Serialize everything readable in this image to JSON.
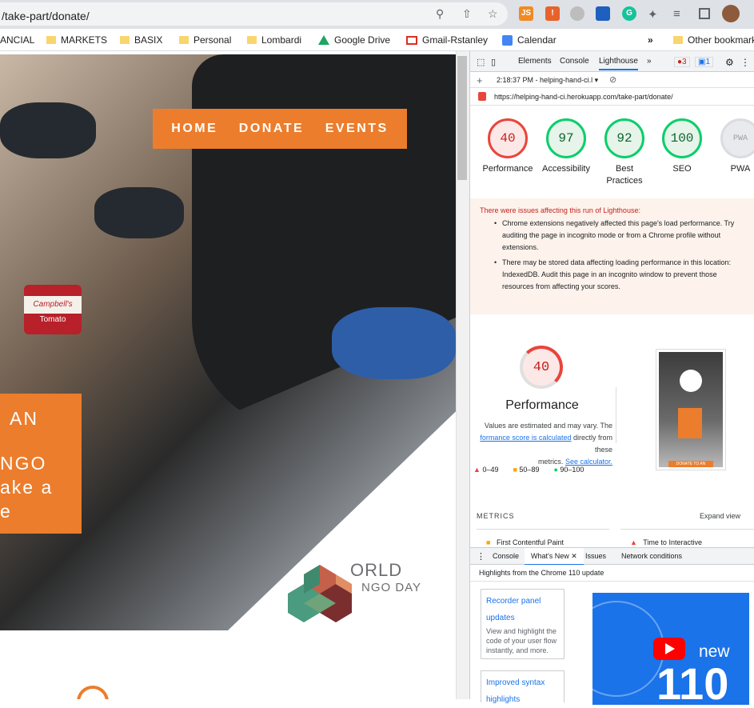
{
  "browser": {
    "url": "/take-part/donate/",
    "extensions": [
      "JS",
      "!",
      "",
      "",
      "G",
      "",
      "",
      ""
    ],
    "bookmarks": [
      "ANCIAL",
      "MARKETS",
      "BASIX",
      "Personal",
      "Lombardi",
      "Google Drive",
      "Gmail-Rstanley",
      "Calendar",
      "Other bookmarks"
    ],
    "more_bookmarks": "»"
  },
  "page": {
    "nav": [
      "HOME",
      "DONATE",
      "EVENTS"
    ],
    "hero_text": [
      "AN",
      "NGO",
      "ake a",
      "e"
    ],
    "logo_text_1": "ORLD",
    "logo_text_2": "NGO DAY",
    "can_label": "Campbell's",
    "can_label_2": "Tomato"
  },
  "devtools": {
    "tabs": [
      "Elements",
      "Console",
      "Lighthouse",
      "»"
    ],
    "error_count": "3",
    "msg_count": "1",
    "report_time": "2:18:37 PM - helping-hand-ci.l",
    "report_url": "https://helping-hand-ci.herokuapp.com/take-part/donate/",
    "scores": [
      {
        "label": "Performance",
        "value": "40",
        "color": "#e8453c",
        "bg": "#fce8e6",
        "fg": "#c5221f"
      },
      {
        "label": "Accessibility",
        "value": "97",
        "color": "#0cce6b",
        "bg": "#e6f4ea",
        "fg": "#0d652d"
      },
      {
        "label": "Best Practices",
        "value": "92",
        "color": "#0cce6b",
        "bg": "#e6f4ea",
        "fg": "#0d652d"
      },
      {
        "label": "SEO",
        "value": "100",
        "color": "#0cce6b",
        "bg": "#e6f4ea",
        "fg": "#0d652d"
      },
      {
        "label": "PWA",
        "value": "PWA",
        "color": "#dadce0",
        "bg": "#e8eaed",
        "fg": "#9aa0a6"
      }
    ],
    "warning_title": "There were issues affecting this run of Lighthouse:",
    "warnings": [
      "Chrome extensions negatively affected this page's load performance. Try auditing the page in incognito mode or from a Chrome profile without extensions.",
      "There may be stored data affecting loading performance in this location: IndexedDB. Audit this page in an incognito window to prevent those resources from affecting your scores."
    ],
    "perf_score": "40",
    "perf_title": "Performance",
    "perf_note_1": "Values are estimated and may vary. The",
    "perf_link": "formance score is calculated",
    "perf_note_2": "directly from these",
    "perf_note_3": "metrics.",
    "perf_calc_link": "See calculator.",
    "legend": [
      "0–49",
      "50–89",
      "90–100"
    ],
    "metrics_label": "METRICS",
    "expand_view": "Expand view",
    "metric_1": "First Contentful Paint",
    "metric_2": "Time to Interactive",
    "thumb_donate": "DONATE TO AN",
    "bottom_tabs": [
      "Console",
      "What's New",
      "Issues",
      "Network conditions"
    ],
    "whatsnew_title": "Highlights from the Chrome 110 update",
    "card1_link": "Recorder panel updates",
    "card1_text": "View and highlight the code of your user flow instantly, and more.",
    "card2_link": "Improved syntax highlights",
    "video_new": "new",
    "video_num": "110"
  }
}
